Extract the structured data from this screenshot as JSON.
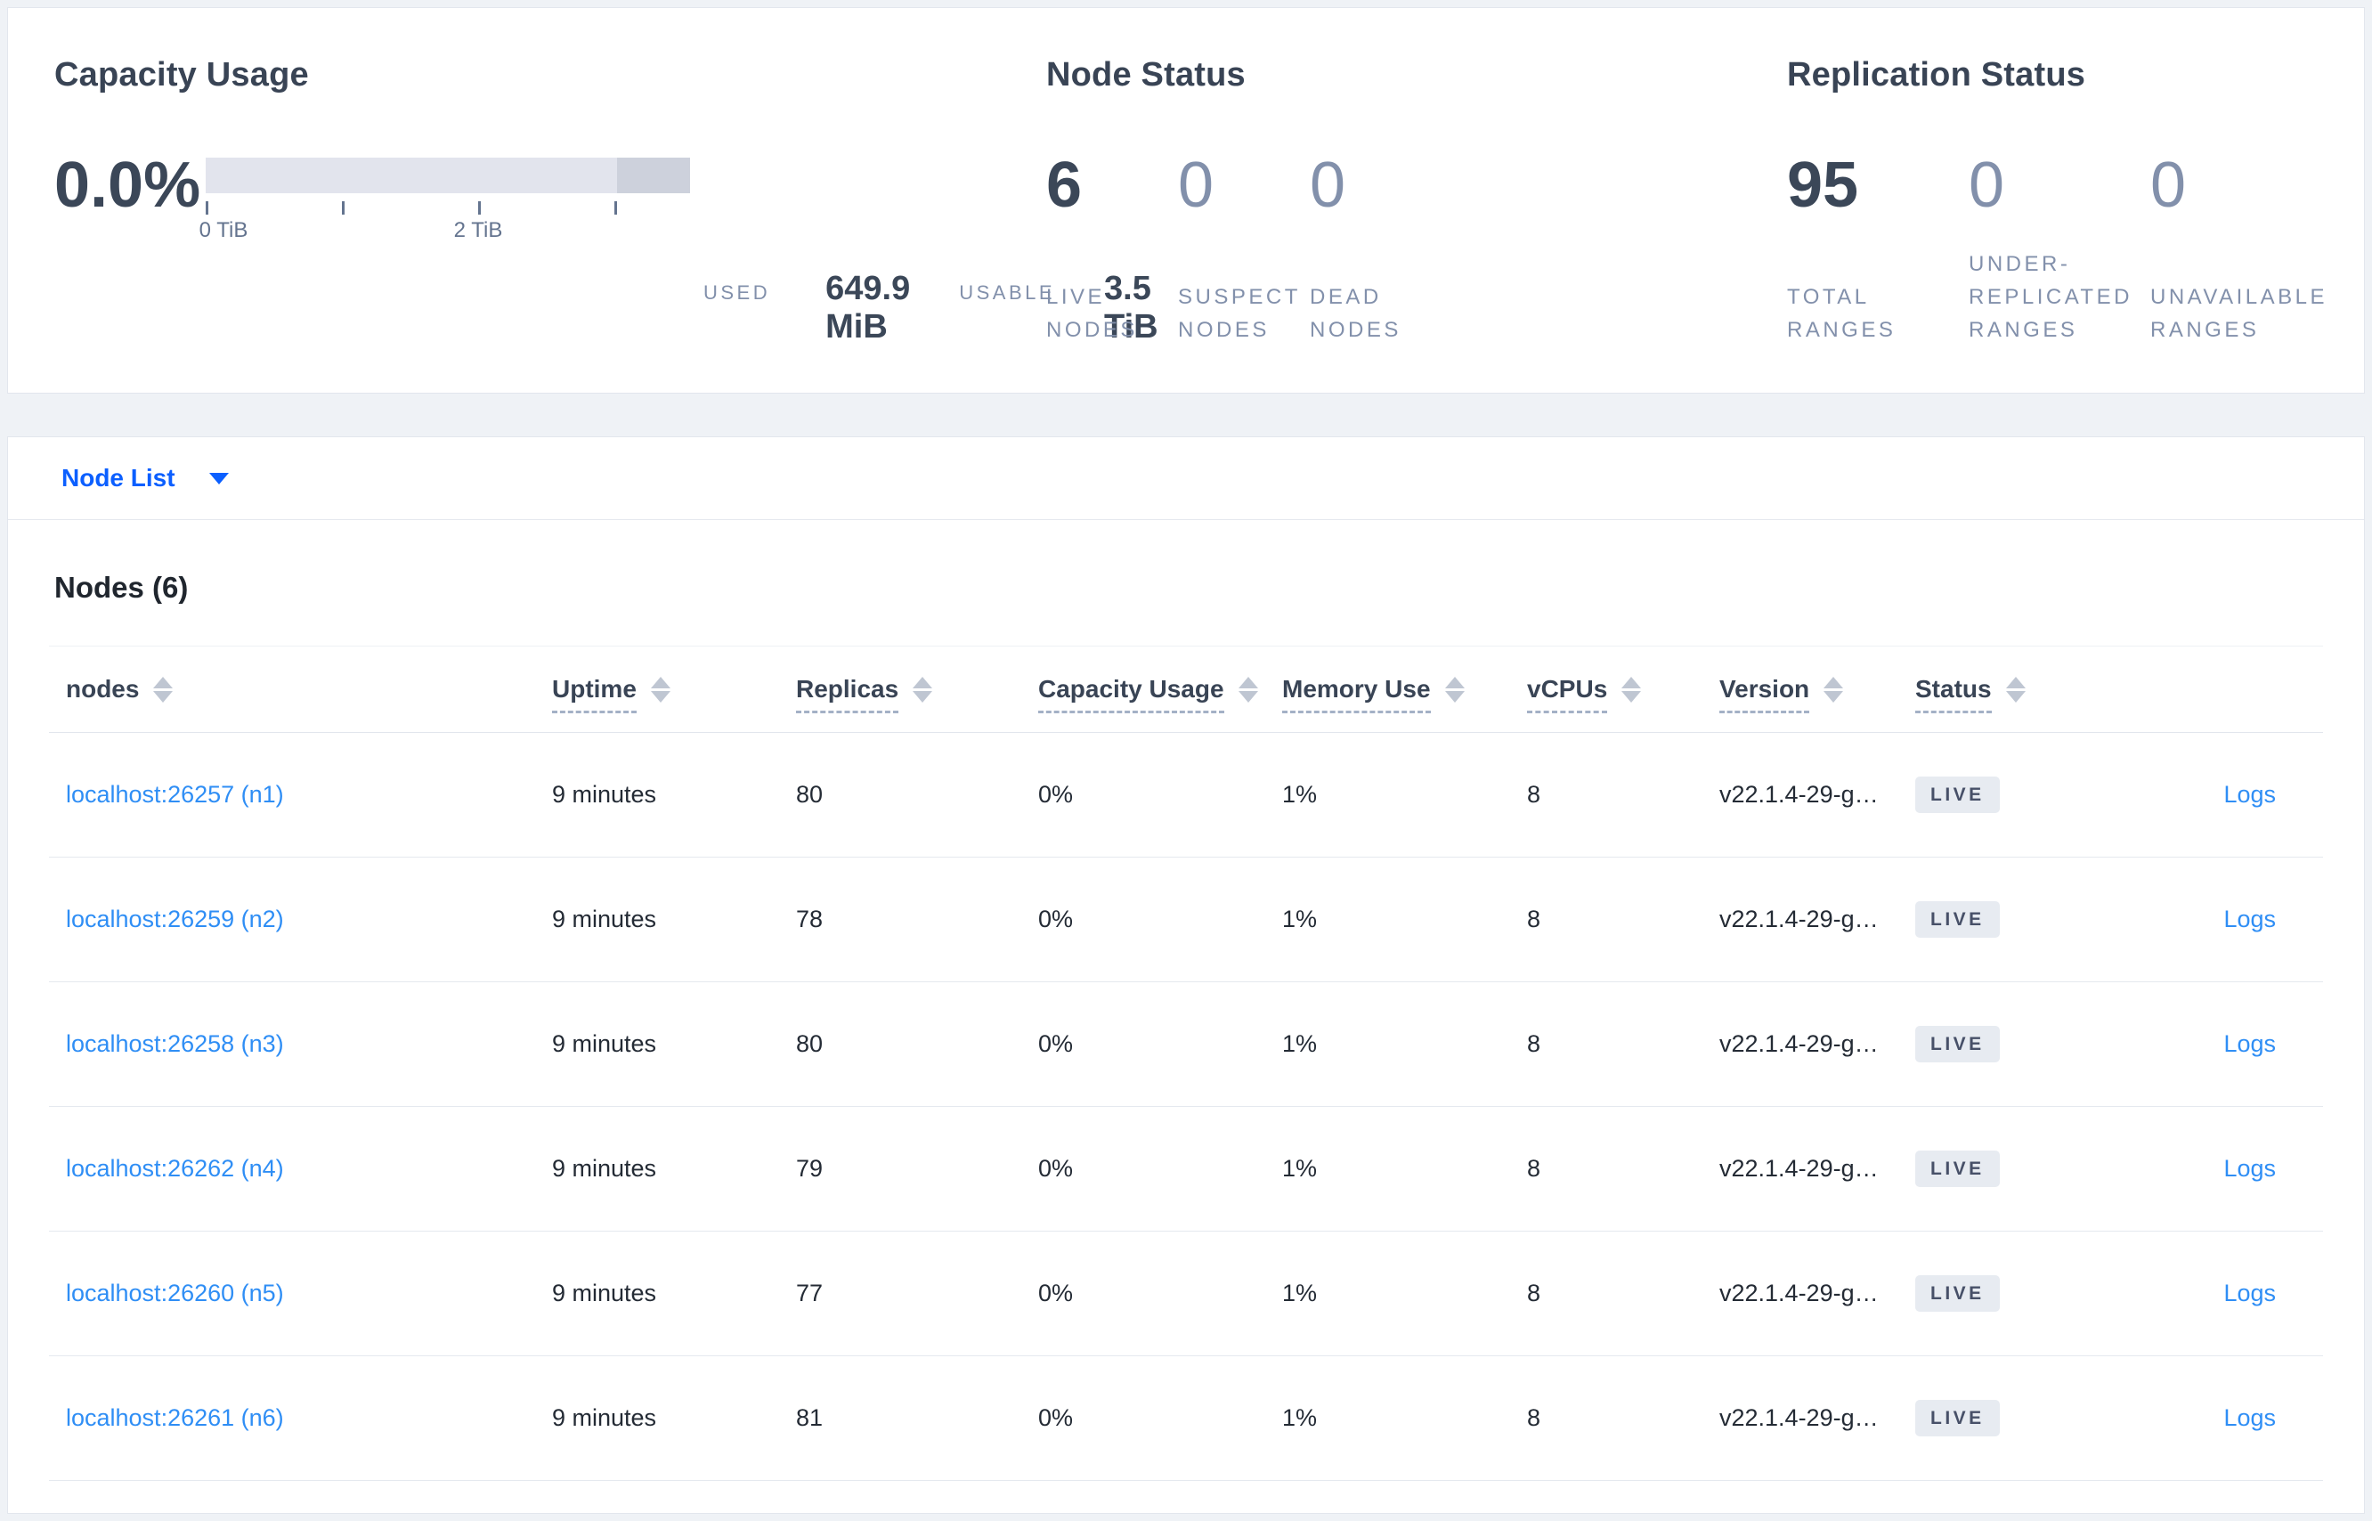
{
  "colors": {
    "page_background": "#eff2f6",
    "card_background": "#ffffff",
    "primary_text": "#394455",
    "muted_text": "#8290ab",
    "accent_blue": "#0b5fff",
    "link_blue": "#2f8ef5",
    "bar_track": "#e2e4ed",
    "bar_dark_segment": "#cdd1dc",
    "badge_background": "#e7ebf1"
  },
  "summary_cards": {
    "capacity": {
      "title": "Capacity Usage",
      "percent_used": "0.0%",
      "gauge": {
        "tick_labels": [
          "0 TiB",
          "2 TiB"
        ],
        "dark_segment_percent": 15.1
      },
      "used_label": "USED",
      "used_value": "649.9 MiB",
      "usable_label": "USABLE",
      "usable_value": "3.5 TiB"
    },
    "node_status": {
      "title": "Node Status",
      "stats": [
        {
          "value": "6",
          "label": "LIVE NODES"
        },
        {
          "value": "0",
          "label": "SUSPECT NODES"
        },
        {
          "value": "0",
          "label": "DEAD NODES"
        }
      ]
    },
    "replication_status": {
      "title": "Replication Status",
      "stats": [
        {
          "value": "95",
          "label": "TOTAL RANGES"
        },
        {
          "value": "0",
          "label": "UNDER-REPLICATED RANGES"
        },
        {
          "value": "0",
          "label": "UNAVAILABLE RANGES"
        }
      ]
    }
  },
  "view_selector": {
    "label": "Node List"
  },
  "nodes_table": {
    "title": "Nodes (6)",
    "columns": [
      "nodes",
      "Uptime",
      "Replicas",
      "Capacity Usage",
      "Memory Use",
      "vCPUs",
      "Version",
      "Status",
      ""
    ],
    "rows": [
      {
        "address": "localhost:26257 (n1)",
        "uptime": "9 minutes",
        "replicas": "80",
        "capacity": "0%",
        "memory": "1%",
        "vcpus": "8",
        "version": "v22.1.4-29-g…",
        "status": "LIVE",
        "logs": "Logs"
      },
      {
        "address": "localhost:26259 (n2)",
        "uptime": "9 minutes",
        "replicas": "78",
        "capacity": "0%",
        "memory": "1%",
        "vcpus": "8",
        "version": "v22.1.4-29-g…",
        "status": "LIVE",
        "logs": "Logs"
      },
      {
        "address": "localhost:26258 (n3)",
        "uptime": "9 minutes",
        "replicas": "80",
        "capacity": "0%",
        "memory": "1%",
        "vcpus": "8",
        "version": "v22.1.4-29-g…",
        "status": "LIVE",
        "logs": "Logs"
      },
      {
        "address": "localhost:26262 (n4)",
        "uptime": "9 minutes",
        "replicas": "79",
        "capacity": "0%",
        "memory": "1%",
        "vcpus": "8",
        "version": "v22.1.4-29-g…",
        "status": "LIVE",
        "logs": "Logs"
      },
      {
        "address": "localhost:26260 (n5)",
        "uptime": "9 minutes",
        "replicas": "77",
        "capacity": "0%",
        "memory": "1%",
        "vcpus": "8",
        "version": "v22.1.4-29-g…",
        "status": "LIVE",
        "logs": "Logs"
      },
      {
        "address": "localhost:26261 (n6)",
        "uptime": "9 minutes",
        "replicas": "81",
        "capacity": "0%",
        "memory": "1%",
        "vcpus": "8",
        "version": "v22.1.4-29-g…",
        "status": "LIVE",
        "logs": "Logs"
      }
    ]
  }
}
